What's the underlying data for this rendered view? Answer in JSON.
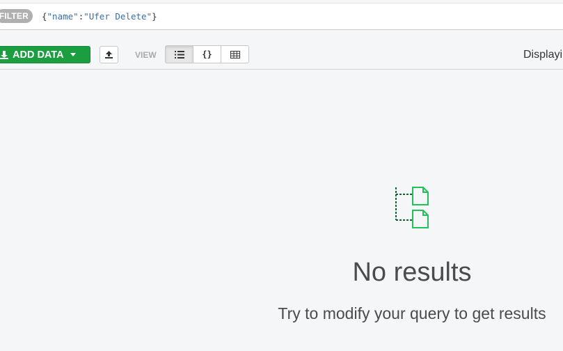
{
  "filter": {
    "label": "FILTER",
    "query_open": "{",
    "query_key": "\"name\"",
    "query_colon": ":",
    "query_value": "\"Ufer Delete\"",
    "query_close": "}"
  },
  "toolbar": {
    "add_data_label": "ADD DATA",
    "view_label": "VIEW",
    "view_modes": [
      "list-view",
      "json-view",
      "table-view"
    ],
    "active_view": "list-view",
    "json_glyph": "{}",
    "displaying_text": "Displayi"
  },
  "empty_state": {
    "title": "No results",
    "hint": "Try to modify your query to get results"
  },
  "colors": {
    "accent_green": "#1a9e40",
    "icon_green": "#1fc25a",
    "icon_dark_green": "#116133"
  }
}
